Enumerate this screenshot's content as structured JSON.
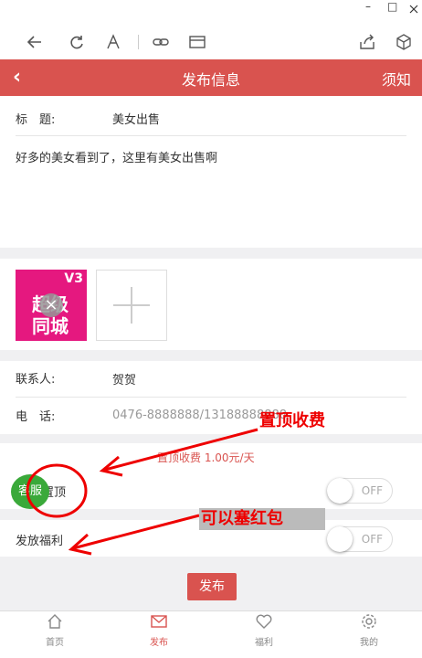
{
  "window": {
    "minimize": "–",
    "maximize": "□"
  },
  "browser": {
    "icons": [
      "back-arrow-icon",
      "refresh-icon",
      "font-icon",
      "link-icon",
      "reader-icon",
      "share-icon",
      "cube-icon"
    ]
  },
  "header": {
    "title": "发布信息",
    "right": "须知",
    "back": "‹"
  },
  "form": {
    "title_label": "标　题:",
    "title_value": "美女出售",
    "content": "好多的美女看到了，这里有美女出售啊",
    "contact_label": "联系人:",
    "contact_value": "贺贺",
    "phone_label": "电　话:",
    "phone_value": "0476-8888888/13188888888",
    "top_fee_text": "置顶收费 1.00元/天",
    "top_label": "置顶",
    "welfare_label": "发放福利",
    "toggle_off": "OFF",
    "publish_label": "发布"
  },
  "image": {
    "badge": "V3",
    "line1": "超级",
    "line2": "同城",
    "close": "×"
  },
  "service": {
    "label": "客服"
  },
  "annotations": {
    "fee": "置顶收费",
    "redpacket": "可以塞红包"
  },
  "tabs": [
    {
      "label": "首页",
      "icon": "home-icon"
    },
    {
      "label": "发布",
      "icon": "mail-icon"
    },
    {
      "label": "福利",
      "icon": "heart-icon"
    },
    {
      "label": "我的",
      "icon": "gear-icon"
    }
  ],
  "colors": {
    "accent": "#d9534f",
    "service_green": "#3aa93a",
    "annotation_red": "#e00000"
  }
}
